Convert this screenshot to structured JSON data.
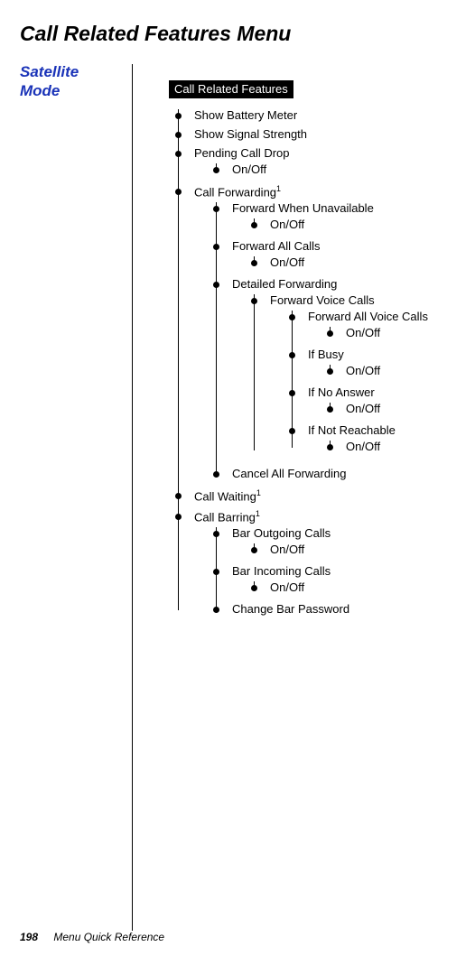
{
  "title": "Call Related Features Menu",
  "side_label_line1": "Satellite",
  "side_label_line2": "Mode",
  "badge": "Call Related Features",
  "footnote_marker": "1",
  "tree": {
    "show_battery": "Show Battery Meter",
    "show_signal": "Show Signal Strength",
    "pending_call_drop": "Pending Call Drop",
    "pending_onoff": "On/Off",
    "call_forwarding": "Call Forwarding",
    "fw_unavail": "Forward When Unavailable",
    "fw_unavail_onoff": "On/Off",
    "fw_all": "Forward All Calls",
    "fw_all_onoff": "On/Off",
    "detailed_fw": "Detailed Forwarding",
    "fw_voice": "Forward Voice Calls",
    "fw_all_voice": "Forward All Voice Calls",
    "fw_all_voice_onoff": "On/Off",
    "if_busy": "If Busy",
    "if_busy_onoff": "On/Off",
    "if_no_answer": "If No Answer",
    "if_no_answer_onoff": "On/Off",
    "if_not_reachable": "If Not Reachable",
    "if_not_reachable_onoff": "On/Off",
    "cancel_all_fw": "Cancel All Forwarding",
    "call_waiting": "Call Waiting",
    "call_barring": "Call Barring",
    "bar_out": "Bar Outgoing Calls",
    "bar_out_onoff": "On/Off",
    "bar_in": "Bar Incoming Calls",
    "bar_in_onoff": "On/Off",
    "change_bar_pw": "Change Bar Password"
  },
  "footer": {
    "page_number": "198",
    "chapter": "Menu Quick Reference"
  }
}
